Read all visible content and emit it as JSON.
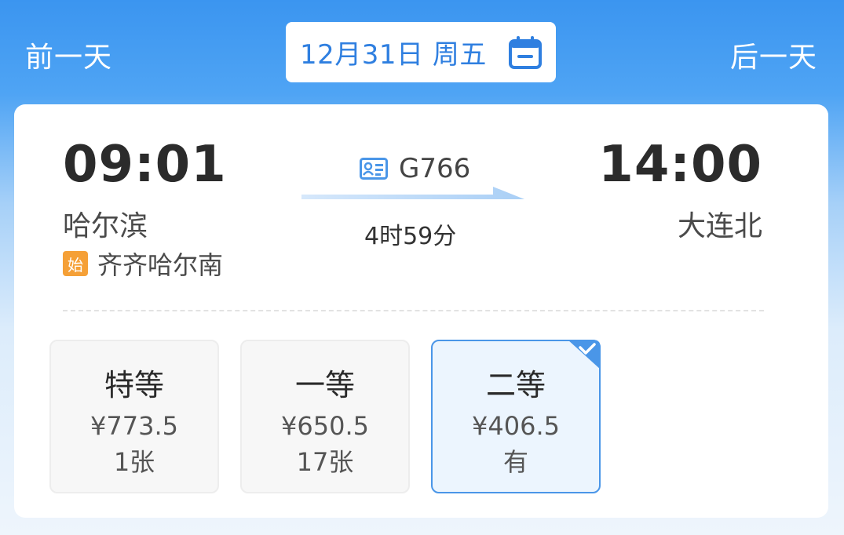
{
  "header": {
    "prev_day": "前一天",
    "next_day": "后一天",
    "date": "12月31日 周五",
    "calendar_icon": "calendar-icon"
  },
  "train": {
    "departure_time": "09:01",
    "arrival_time": "14:00",
    "departure_station": "哈尔滨",
    "arrival_station": "大连北",
    "origin_badge": "始",
    "origin_station": "齐齐哈尔南",
    "train_number": "G766",
    "duration": "4时59分",
    "train_icon": "id-card-icon"
  },
  "seats": [
    {
      "class": "特等",
      "price": "¥773.5",
      "availability": "1张",
      "selected": false
    },
    {
      "class": "一等",
      "price": "¥650.5",
      "availability": "17张",
      "selected": false
    },
    {
      "class": "二等",
      "price": "¥406.5",
      "availability": "有",
      "selected": true
    }
  ],
  "colors": {
    "primary": "#3b95f0",
    "accent_text": "#2f7fe0",
    "badge": "#f5a037",
    "selected_border": "#4a96e8"
  }
}
